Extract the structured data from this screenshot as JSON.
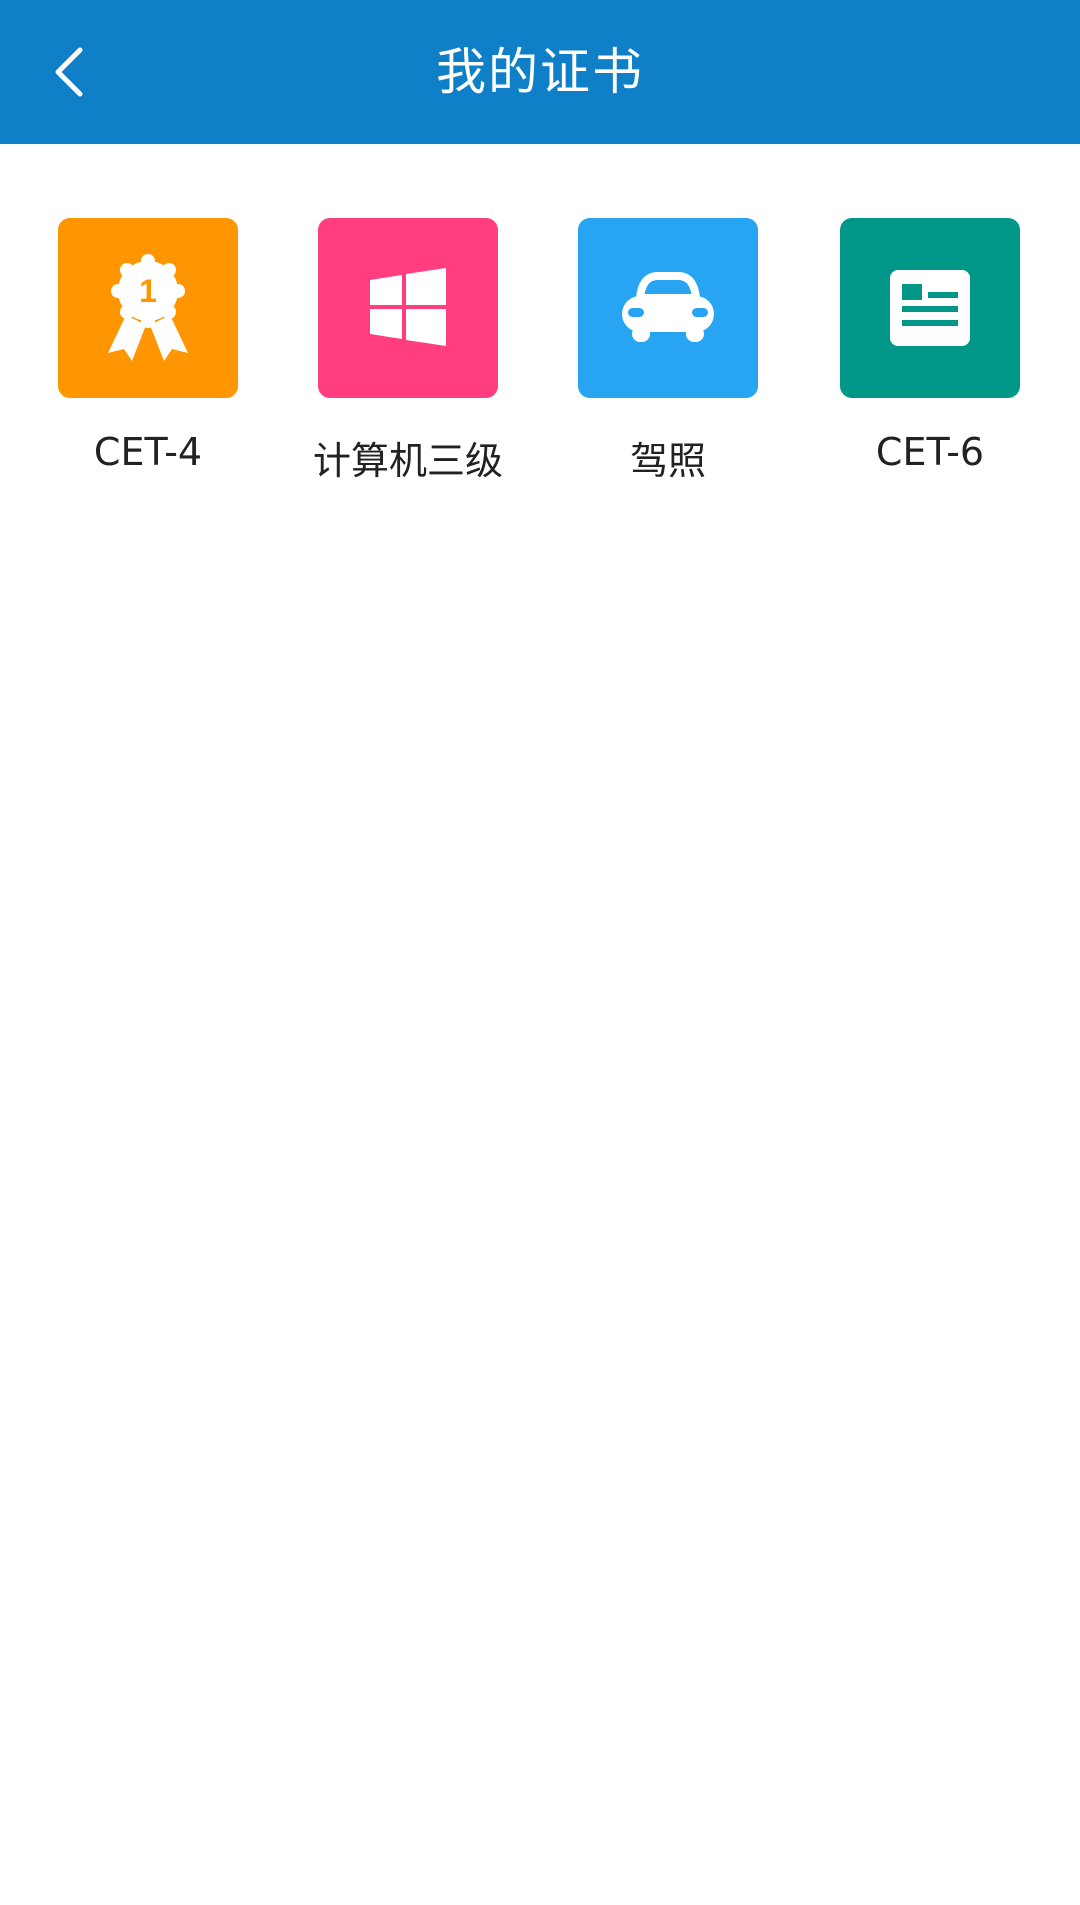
{
  "header": {
    "title": "我的证书",
    "back_icon": "chevron-left-icon",
    "background": "#0f7fc8"
  },
  "certificates": [
    {
      "label": "CET-4",
      "icon": "award-ribbon-icon",
      "badge_number": "1",
      "color": "#ff9500"
    },
    {
      "label": "计算机三级",
      "icon": "windows-logo-icon",
      "color": "#ff3d7f"
    },
    {
      "label": "驾照",
      "icon": "car-icon",
      "color": "#27a4f2"
    },
    {
      "label": "CET-6",
      "icon": "newspaper-icon",
      "color": "#009688"
    }
  ]
}
